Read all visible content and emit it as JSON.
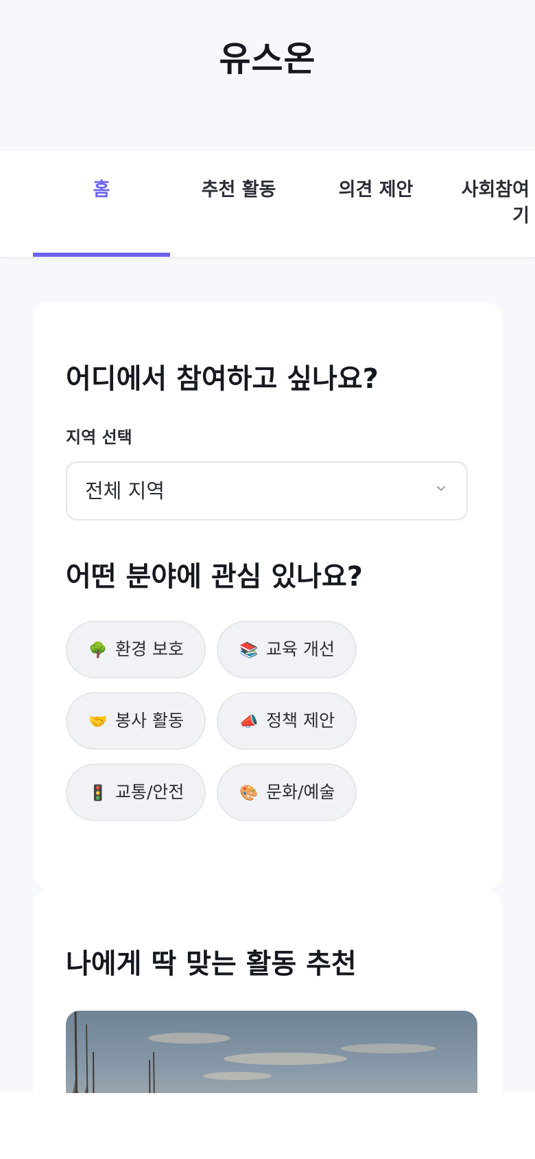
{
  "app": {
    "title": "유스온"
  },
  "tabs": [
    {
      "label": "홈",
      "active": true
    },
    {
      "label": "추천 활동",
      "active": false
    },
    {
      "label": "의견 제안",
      "active": false
    },
    {
      "label": "사회참여\n기",
      "active": false
    }
  ],
  "region_section": {
    "title": "어디에서 참여하고 싶나요?",
    "field_label": "지역 선택",
    "selected_value": "전체 지역"
  },
  "interest_section": {
    "title": "어떤 분야에 관심 있나요?",
    "chips": [
      {
        "icon": "🌳",
        "icon_name": "tree-icon",
        "label": "환경 보호"
      },
      {
        "icon": "📚",
        "icon_name": "books-icon",
        "label": "교육 개선"
      },
      {
        "icon": "🤝",
        "icon_name": "handshake-icon",
        "label": "봉사 활동"
      },
      {
        "icon": "📣",
        "icon_name": "megaphone-icon",
        "label": "정책 제안"
      },
      {
        "icon": "🚦",
        "icon_name": "traffic-light-icon",
        "label": "교통/안전"
      },
      {
        "icon": "🎨",
        "icon_name": "palette-icon",
        "label": "문화/예술"
      }
    ]
  },
  "recommend_section": {
    "title": "나에게 딱 맞는 활동 추천"
  },
  "colors": {
    "accent": "#6c63f0",
    "page_background": "#f6f8fb",
    "card_background": "#ffffff",
    "chip_background": "#f1f2f5",
    "text_primary": "#16181f"
  }
}
